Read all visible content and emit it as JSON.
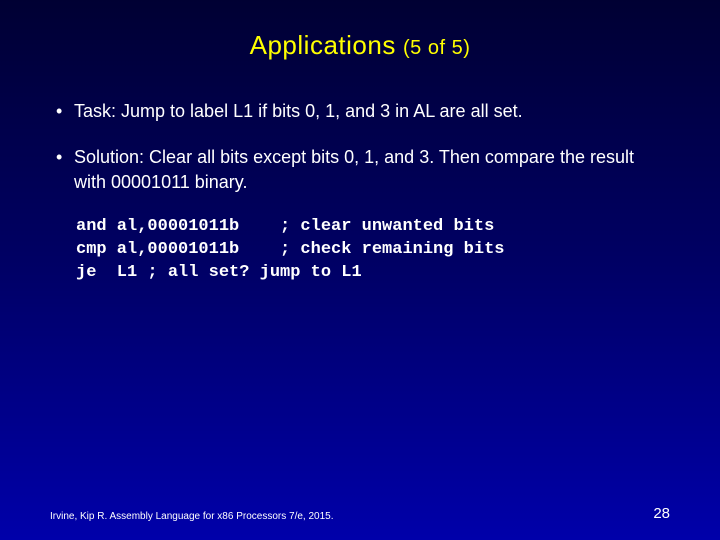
{
  "title": {
    "main": "Applications",
    "sub": "(5 of 5)"
  },
  "bullets": [
    "Task: Jump to label L1 if bits 0, 1, and 3 in AL are all set.",
    "Solution: Clear all bits except bits 0, 1, and 3. Then compare the result with 00001011 binary."
  ],
  "code": "and al,00001011b    ; clear unwanted bits\ncmp al,00001011b    ; check remaining bits\nje  L1 ; all set? jump to L1",
  "footer": {
    "citation": "Irvine, Kip R. Assembly Language for x86 Processors 7/e, 2015.",
    "page": "28"
  }
}
